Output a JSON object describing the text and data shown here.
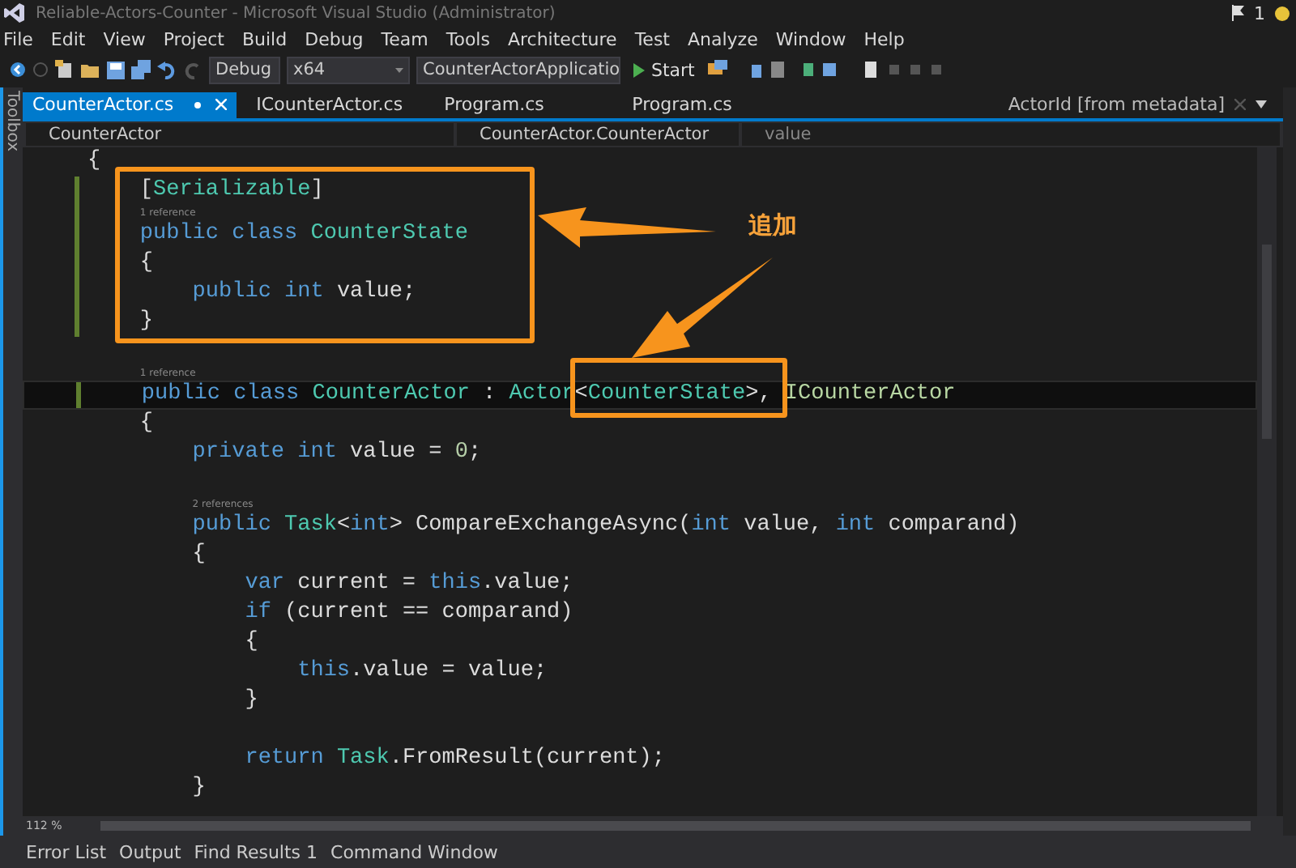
{
  "window": {
    "title": "Reliable-Actors-Counter - Microsoft Visual Studio (Administrator)",
    "notification_count": "1"
  },
  "menu": [
    "File",
    "Edit",
    "View",
    "Project",
    "Build",
    "Debug",
    "Team",
    "Tools",
    "Architecture",
    "Test",
    "Analyze",
    "Window",
    "Help"
  ],
  "toolbar": {
    "configuration": "Debug",
    "platform": "x64",
    "startup_project": "CounterActorApplicatio",
    "start": "Start"
  },
  "side_panel": {
    "label": "Toolbox"
  },
  "tabs": [
    {
      "label": "CounterActor.cs",
      "selected": true
    },
    {
      "label": "ICounterActor.cs",
      "selected": false
    },
    {
      "label": "Program.cs",
      "selected": false
    },
    {
      "label": "Program.cs",
      "selected": false
    }
  ],
  "preview_tab": {
    "label": "ActorId [from metadata]"
  },
  "navigation": {
    "type": "CounterActor",
    "member_scope": "CounterActor.CounterActor",
    "member": "value"
  },
  "code": [
    {
      "kind": "code",
      "changed": false,
      "current": false,
      "tokens": [
        {
          "text": "{",
          "kind": "plain"
        }
      ]
    },
    {
      "kind": "code",
      "changed": true,
      "current": false,
      "tokens": [
        {
          "text": "    [",
          "kind": "plain"
        },
        {
          "text": "Serializable",
          "kind": "type"
        },
        {
          "text": "]",
          "kind": "plain"
        }
      ]
    },
    {
      "kind": "code",
      "changed": true,
      "current": false,
      "lens": "1 reference",
      "tokens": [
        {
          "text": "    public class ",
          "kind": "keyword"
        },
        {
          "text": "CounterState",
          "kind": "type"
        }
      ]
    },
    {
      "kind": "code",
      "changed": true,
      "current": false,
      "tokens": [
        {
          "text": "    {",
          "kind": "plain"
        }
      ]
    },
    {
      "kind": "code",
      "changed": true,
      "current": false,
      "tokens": [
        {
          "text": "        public int ",
          "kind": "keyword"
        },
        {
          "text": "value;",
          "kind": "plain"
        }
      ]
    },
    {
      "kind": "code",
      "changed": true,
      "current": false,
      "tokens": [
        {
          "text": "    }",
          "kind": "plain"
        }
      ]
    },
    {
      "kind": "blank",
      "changed": false,
      "current": false
    },
    {
      "kind": "code",
      "changed": true,
      "current": true,
      "lens": "1 reference",
      "tokens": [
        {
          "text": "    public class ",
          "kind": "keyword"
        },
        {
          "text": "CounterActor",
          "kind": "type"
        },
        {
          "text": " : ",
          "kind": "plain"
        },
        {
          "text": "Actor",
          "kind": "type"
        },
        {
          "text": "<",
          "kind": "plain"
        },
        {
          "text": "CounterState",
          "kind": "type"
        },
        {
          "text": ">, ",
          "kind": "plain"
        },
        {
          "text": "ICounterActor",
          "kind": "interface"
        }
      ]
    },
    {
      "kind": "code",
      "changed": false,
      "current": false,
      "tokens": [
        {
          "text": "    {",
          "kind": "plain"
        }
      ]
    },
    {
      "kind": "code",
      "changed": false,
      "current": false,
      "tokens": [
        {
          "text": "        private int ",
          "kind": "keyword"
        },
        {
          "text": "value = ",
          "kind": "plain"
        },
        {
          "text": "0",
          "kind": "number"
        },
        {
          "text": ";",
          "kind": "plain"
        }
      ]
    },
    {
      "kind": "blank",
      "changed": false,
      "current": false
    },
    {
      "kind": "code",
      "changed": false,
      "current": false,
      "lens": "2 references",
      "tokens": [
        {
          "text": "        public ",
          "kind": "keyword"
        },
        {
          "text": "Task",
          "kind": "type"
        },
        {
          "text": "<",
          "kind": "plain"
        },
        {
          "text": "int",
          "kind": "keyword"
        },
        {
          "text": "> CompareExchangeAsync(",
          "kind": "plain"
        },
        {
          "text": "int ",
          "kind": "keyword"
        },
        {
          "text": "value, ",
          "kind": "plain"
        },
        {
          "text": "int ",
          "kind": "keyword"
        },
        {
          "text": "comparand)",
          "kind": "plain"
        }
      ]
    },
    {
      "kind": "code",
      "changed": false,
      "current": false,
      "tokens": [
        {
          "text": "        {",
          "kind": "plain"
        }
      ]
    },
    {
      "kind": "code",
      "changed": false,
      "current": false,
      "tokens": [
        {
          "text": "            var ",
          "kind": "keyword"
        },
        {
          "text": "current = ",
          "kind": "plain"
        },
        {
          "text": "this",
          "kind": "keyword"
        },
        {
          "text": ".value;",
          "kind": "plain"
        }
      ]
    },
    {
      "kind": "code",
      "changed": false,
      "current": false,
      "tokens": [
        {
          "text": "            if ",
          "kind": "keyword"
        },
        {
          "text": "(current == comparand)",
          "kind": "plain"
        }
      ]
    },
    {
      "kind": "code",
      "changed": false,
      "current": false,
      "tokens": [
        {
          "text": "            {",
          "kind": "plain"
        }
      ]
    },
    {
      "kind": "code",
      "changed": false,
      "current": false,
      "tokens": [
        {
          "text": "                this",
          "kind": "keyword"
        },
        {
          "text": ".value = value;",
          "kind": "plain"
        }
      ]
    },
    {
      "kind": "code",
      "changed": false,
      "current": false,
      "tokens": [
        {
          "text": "            }",
          "kind": "plain"
        }
      ]
    },
    {
      "kind": "blank",
      "changed": false,
      "current": false
    },
    {
      "kind": "code",
      "changed": false,
      "current": false,
      "tokens": [
        {
          "text": "            return ",
          "kind": "keyword"
        },
        {
          "text": "Task",
          "kind": "type"
        },
        {
          "text": ".FromResult(current);",
          "kind": "plain"
        }
      ]
    },
    {
      "kind": "code",
      "changed": false,
      "current": false,
      "tokens": [
        {
          "text": "        }",
          "kind": "plain"
        }
      ]
    }
  ],
  "zoom": "112 %",
  "annotation": {
    "label": "追加"
  },
  "bottom_tabs": [
    "Error List",
    "Output",
    "Find Results 1",
    "Command Window"
  ]
}
